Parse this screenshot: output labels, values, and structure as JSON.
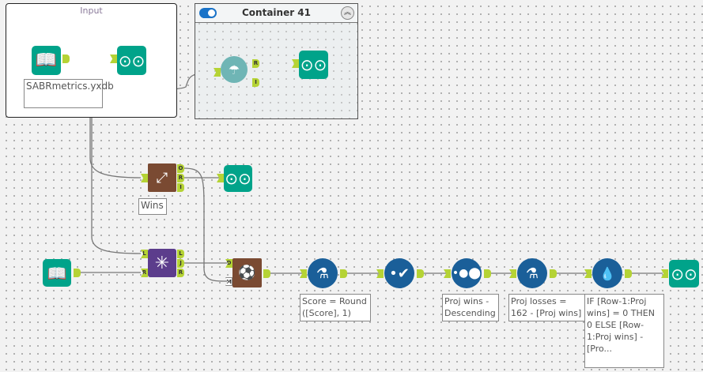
{
  "containers": {
    "input": {
      "title": "Input"
    },
    "container41": {
      "title": "Container 41",
      "collapse_icon": "︽"
    }
  },
  "annotations": {
    "input_file": "SABRmetrics.yxdb",
    "wins": "Wins",
    "formula1": "Score = Round ([Score], 1)",
    "sort": "Proj wins - Descending",
    "formula2": "Proj losses = 162 - [Proj wins]",
    "multirow": "IF [Row-1:Proj wins] = 0 THEN 0 ELSE [Row-1:Proj wins] - [Pro..."
  },
  "anchors": {
    "O": "O",
    "R": "R",
    "I": "I",
    "L": "L",
    "J": "J",
    "D": "D",
    "M": "M"
  },
  "colors": {
    "input": "#00a38a",
    "predictive": "#7a4a32",
    "join": "#5c3d8c",
    "prep": "#1a5f99",
    "anchor": "#b5d335"
  }
}
